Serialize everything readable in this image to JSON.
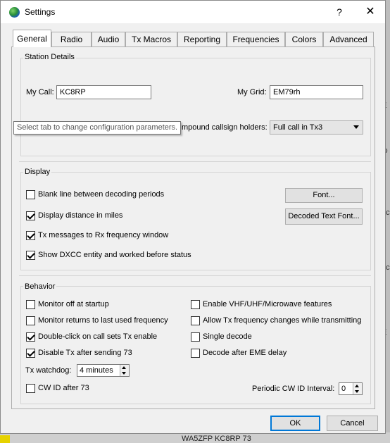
{
  "window": {
    "title": "Settings",
    "help_glyph": "?",
    "close_glyph": "✕"
  },
  "tabs": [
    {
      "label": "General",
      "active": true
    },
    {
      "label": "Radio"
    },
    {
      "label": "Audio"
    },
    {
      "label": "Tx Macros"
    },
    {
      "label": "Reporting"
    },
    {
      "label": "Frequencies"
    },
    {
      "label": "Colors"
    },
    {
      "label": "Advanced"
    }
  ],
  "station": {
    "title": "Station Details",
    "my_call_label": "My Call:",
    "my_call_value": "KC8RP",
    "my_grid_label": "My Grid:",
    "my_grid_value": "EM79rh",
    "compound_label": "mpound callsign holders:",
    "compound_value": "Full call in Tx3",
    "tooltip": "Select tab to change configuration parameters."
  },
  "display": {
    "title": "Display",
    "options": [
      {
        "label": "Blank line between decoding periods",
        "checked": false
      },
      {
        "label": "Display distance in miles",
        "checked": true
      },
      {
        "label": "Tx messages to Rx frequency window",
        "checked": true
      },
      {
        "label": "Show DXCC entity and worked before status",
        "checked": true
      }
    ],
    "font_button": "Font...",
    "decoded_font_button": "Decoded Text Font..."
  },
  "behavior": {
    "title": "Behavior",
    "left": [
      {
        "label": "Monitor off at startup",
        "checked": false
      },
      {
        "label": "Monitor returns to last used frequency",
        "checked": false
      },
      {
        "label": "Double-click on call sets Tx enable",
        "checked": true
      },
      {
        "label": "Disable Tx after sending 73",
        "checked": true
      }
    ],
    "right": [
      {
        "label": "Enable VHF/UHF/Microwave features",
        "checked": false
      },
      {
        "label": "Allow Tx frequency changes while transmitting",
        "checked": false
      },
      {
        "label": "Single decode",
        "checked": false
      },
      {
        "label": "Decode after EME delay",
        "checked": false
      }
    ],
    "watchdog_label": "Tx watchdog:",
    "watchdog_value": "4 minutes",
    "cw_id_label": "CW ID after 73",
    "cw_id_checked": false,
    "cw_interval_label": "Periodic CW ID Interval:",
    "cw_interval_value": "0"
  },
  "buttons": {
    "ok": "OK",
    "cancel": "Cancel"
  },
  "background": {
    "bottom_text": "WA5ZFP KC8RP 73",
    "side_fragments": [
      "io",
      "ac",
      "E",
      "ac",
      "Il",
      "E",
      "r"
    ]
  },
  "colors": {
    "accent": "#0078d7",
    "window_bg": "#f0f0f0"
  }
}
